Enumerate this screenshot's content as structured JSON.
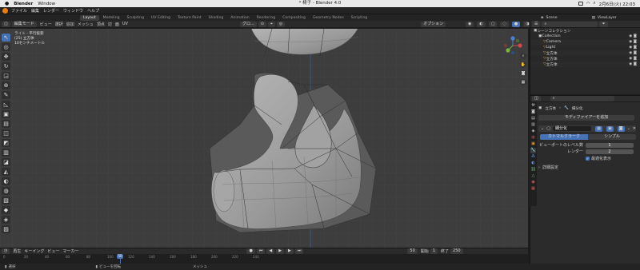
{
  "menubar": {
    "app": "Blender",
    "items": [
      "Window"
    ],
    "clock": "2月6日(火) 22:03"
  },
  "window_title": "* 椅子 - Blender 4.0",
  "top_menu": [
    "ファイル",
    "編集",
    "レンダー",
    "ウィンドウ",
    "ヘルプ"
  ],
  "workspace_tabs": [
    "Layout",
    "Modeling",
    "Sculpting",
    "UV Editing",
    "Texture Paint",
    "Shading",
    "Animation",
    "Rendering",
    "Compositing",
    "Geometry Nodes",
    "Scripting"
  ],
  "active_tab": "Layout",
  "scene": {
    "name": "Scene",
    "view_layer": "ViewLayer"
  },
  "viewport_header": {
    "mode": "編集モード",
    "menus": [
      "ビュー",
      "選択",
      "追加",
      "メッシュ",
      "頂点",
      "辺",
      "面",
      "UV"
    ],
    "orientation": "グロ...",
    "options": "オプション"
  },
  "viewport_info": {
    "line1": "ライト - 平行投影",
    "line2": "(25) 立方体",
    "line3": "10センチメートル"
  },
  "tools": [
    {
      "icon": "select-icon",
      "glyph": "↖"
    },
    {
      "icon": "cursor-icon",
      "glyph": "◎"
    },
    {
      "icon": "move-icon",
      "glyph": "✥"
    },
    {
      "icon": "rotate-icon",
      "glyph": "↻"
    },
    {
      "icon": "scale-icon",
      "glyph": "◲"
    },
    {
      "icon": "transform-icon",
      "glyph": "⊕"
    },
    {
      "icon": "annotate-icon",
      "glyph": "✎"
    },
    {
      "icon": "measure-icon",
      "glyph": "◺"
    },
    {
      "icon": "add-cube-icon",
      "glyph": "▣"
    },
    {
      "icon": "extrude-icon",
      "glyph": "▤"
    },
    {
      "icon": "inset-icon",
      "glyph": "◫"
    },
    {
      "icon": "bevel-icon",
      "glyph": "◩"
    },
    {
      "icon": "loopcut-icon",
      "glyph": "▥"
    },
    {
      "icon": "knife-icon",
      "glyph": "◪"
    },
    {
      "icon": "polybuild-icon",
      "glyph": "◭"
    },
    {
      "icon": "spin-icon",
      "glyph": "◐"
    },
    {
      "icon": "smooth-icon",
      "glyph": "◍"
    },
    {
      "icon": "edgeslide-icon",
      "glyph": "▧"
    },
    {
      "icon": "shrink-icon",
      "glyph": "◆"
    },
    {
      "icon": "shear-icon",
      "glyph": "◈"
    },
    {
      "icon": "rip-icon",
      "glyph": "▨"
    }
  ],
  "outliner": {
    "title": "シーンコレクション",
    "items": [
      {
        "label": "Collection",
        "indent": 1
      },
      {
        "label": "Camera",
        "indent": 2
      },
      {
        "label": "Light",
        "indent": 2
      },
      {
        "label": "立方体",
        "indent": 2
      },
      {
        "label": "立方体",
        "indent": 2
      },
      {
        "label": "立方体",
        "indent": 2
      }
    ]
  },
  "properties": {
    "object_name": "立方体",
    "modifier_name": "細分化",
    "add_modifier": "モディファイアーを追加",
    "modifier_field": "細分化",
    "tab_catmull": "カトマルクラーク",
    "tab_simple": "シンプル",
    "viewport_levels_label": "ビューポートのレベル数",
    "viewport_levels_value": "1",
    "render_label": "レンダー",
    "render_value": "2",
    "optimal_display": "最適化表示",
    "advanced": "詳細設定"
  },
  "timeline": {
    "menus": [
      "再生",
      "キーイング",
      "ビュー",
      "マーカー"
    ],
    "frame_ticks": [
      "0",
      "20",
      "40",
      "60",
      "80",
      "100",
      "120",
      "140",
      "160",
      "180",
      "200",
      "220",
      "240"
    ],
    "current_frame": "50",
    "start": "1",
    "end": "250",
    "start_label": "開始",
    "end_label": "終了"
  },
  "status": {
    "left": "選択",
    "mid": "ビューを回転",
    "right": "メッシュ"
  },
  "colors": {
    "accent": "#4772b3",
    "orange": "#e87d0d",
    "mesh": "#9a9a9a"
  }
}
